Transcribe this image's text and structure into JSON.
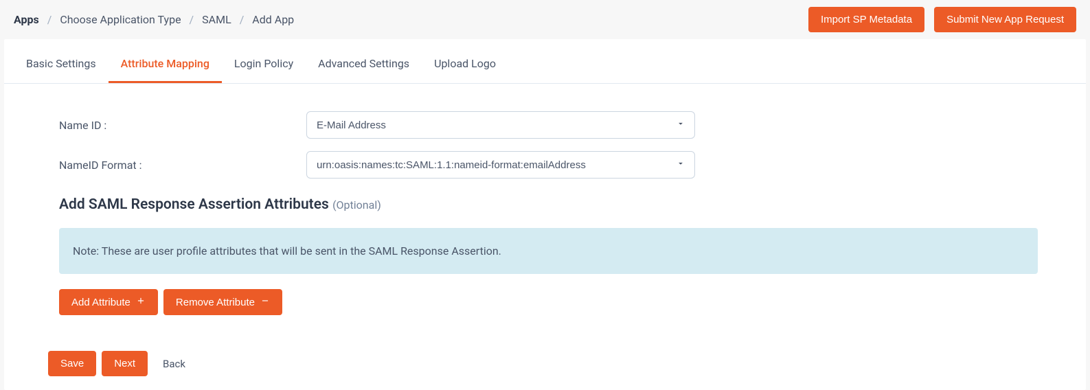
{
  "breadcrumb": {
    "items": [
      {
        "label": "Apps",
        "link": true,
        "strong": true
      },
      {
        "label": "Choose Application Type",
        "link": true,
        "strong": false
      },
      {
        "label": "SAML",
        "link": true,
        "strong": false
      },
      {
        "label": "Add App",
        "link": false,
        "strong": false
      }
    ],
    "separator": "/"
  },
  "top_buttons": {
    "import_sp": "Import SP Metadata",
    "submit_request": "Submit New App Request"
  },
  "tabs": [
    {
      "label": "Basic Settings",
      "active": false
    },
    {
      "label": "Attribute Mapping",
      "active": true
    },
    {
      "label": "Login Policy",
      "active": false
    },
    {
      "label": "Advanced Settings",
      "active": false
    },
    {
      "label": "Upload Logo",
      "active": false
    }
  ],
  "form": {
    "name_id": {
      "label": "Name ID :",
      "value": "E-Mail Address"
    },
    "nameid_format": {
      "label": "NameID Format :",
      "value": "urn:oasis:names:tc:SAML:1.1:nameid-format:emailAddress"
    }
  },
  "section": {
    "title": "Add SAML Response Assertion Attributes",
    "optional": "(Optional)"
  },
  "note": "Note: These are user profile attributes that will be sent in the SAML Response Assertion.",
  "buttons": {
    "add_attribute": "Add Attribute",
    "remove_attribute": "Remove Attribute",
    "save": "Save",
    "next": "Next",
    "back": "Back"
  },
  "colors": {
    "accent": "#ec5b27",
    "note_bg": "#d4ebf2"
  }
}
